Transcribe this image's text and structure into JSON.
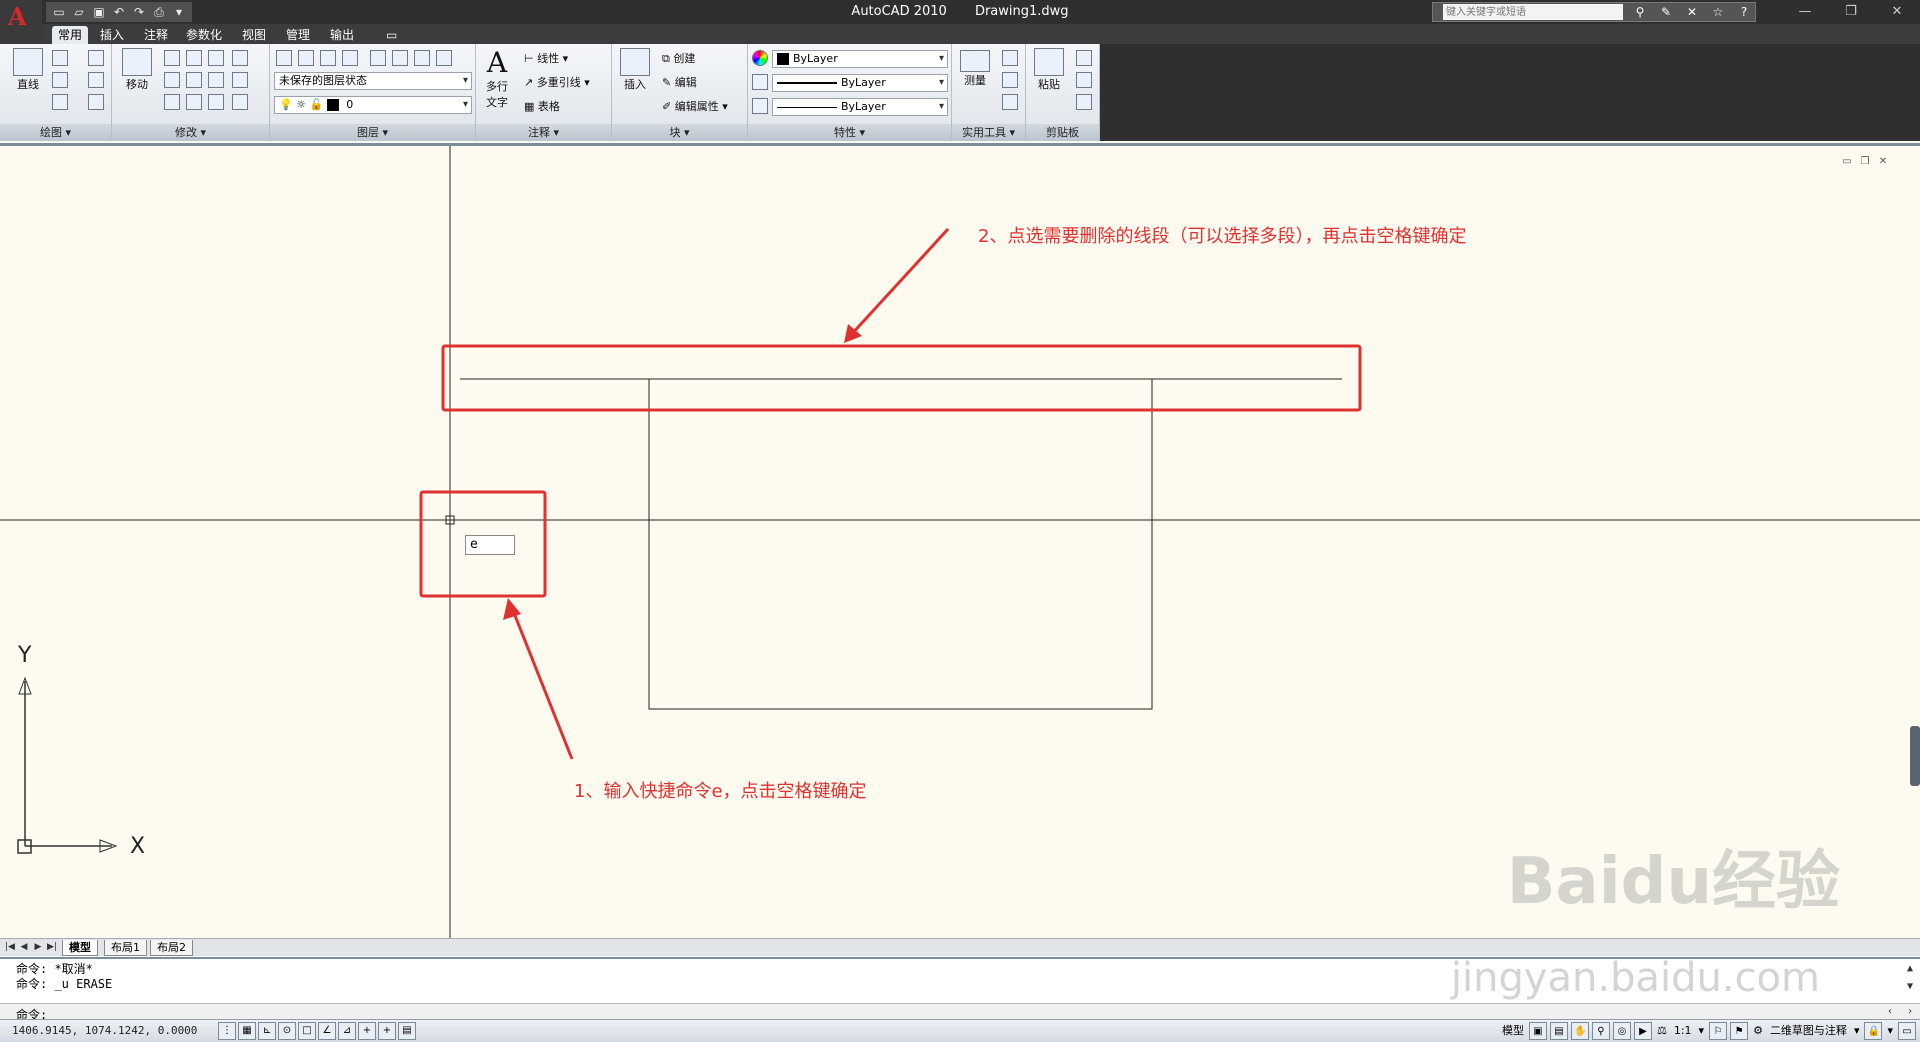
{
  "titlebar": {
    "app_name": "AutoCAD 2010",
    "file_name": "Drawing1.dwg",
    "search_placeholder": "键入关键字或短语"
  },
  "tabs": [
    {
      "label": "常用"
    },
    {
      "label": "插入"
    },
    {
      "label": "注释"
    },
    {
      "label": "参数化"
    },
    {
      "label": "视图"
    },
    {
      "label": "管理"
    },
    {
      "label": "输出"
    }
  ],
  "ribbon": {
    "draw": {
      "title": "绘图",
      "line": "直线"
    },
    "modify": {
      "title": "修改",
      "move": "移动"
    },
    "layer": {
      "title": "图层",
      "state": "未保存的图层状态",
      "current_layer": "0"
    },
    "annotation": {
      "title": "注释",
      "mtext_line1": "多行",
      "mtext_line2": "文字",
      "linear": "线性",
      "mleader": "多重引线",
      "table": "表格"
    },
    "block": {
      "title": "块",
      "insert": "插入",
      "create": "创建",
      "edit": "编辑",
      "edit_attr": "编辑属性"
    },
    "properties": {
      "title": "特性",
      "color": "ByLayer",
      "lineweight": "ByLayer",
      "linetype": "ByLayer"
    },
    "utilities": {
      "title": "实用工具",
      "measure": "测量"
    },
    "clipboard": {
      "title": "剪贴板",
      "paste": "粘贴"
    }
  },
  "canvas": {
    "cmd_input_value": "e",
    "annotation_step1": "1、输入快捷命令e，点击空格键确定",
    "annotation_step2": "2、点选需要删除的线段（可以选择多段），再点击空格键确定",
    "ucs_x": "X",
    "ucs_y": "Y"
  },
  "layout_tabs": [
    {
      "label": "模型"
    },
    {
      "label": "布局1"
    },
    {
      "label": "布局2"
    }
  ],
  "command": {
    "line1": "命令: *取消*",
    "line2": "命令: _u ERASE",
    "prompt": "命令:"
  },
  "status": {
    "coords": "1406.9145, 1074.1242, 0.0000",
    "model_label": "模型",
    "scale": "1:1",
    "workspace": "二维草图与注释"
  },
  "watermark": {
    "brand": "Baidu经验",
    "url": "jingyan.baidu.com"
  },
  "colors": {
    "annotation_red": "#e03131",
    "canvas_bg": "#fdfaef",
    "titlebar_bg": "#2f2f2f"
  }
}
